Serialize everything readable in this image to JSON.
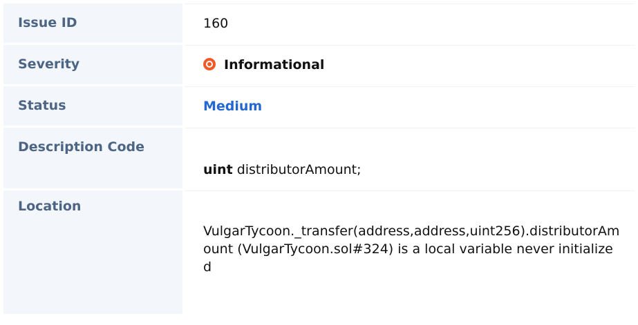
{
  "issue": {
    "id_label": "Issue ID",
    "id_value": "160",
    "severity_label": "Severity",
    "severity_icon": "target-icon",
    "severity_value": "Informational",
    "status_label": "Status",
    "status_value": "Medium",
    "description_label": "Description Code",
    "code_keyword": "uint",
    "code_rest": " distributorAmount;",
    "location_label": "Location",
    "location_value": "VulgarTycoon._transfer(address,address,uint256).distributorAmount (VulgarTycoon.sol#324) is a local variable never initialized"
  },
  "colors": {
    "label_background": "#f3f6fa",
    "label_text": "#4c6584",
    "severity_icon": "#f05a28",
    "status_text": "#2367d1"
  }
}
